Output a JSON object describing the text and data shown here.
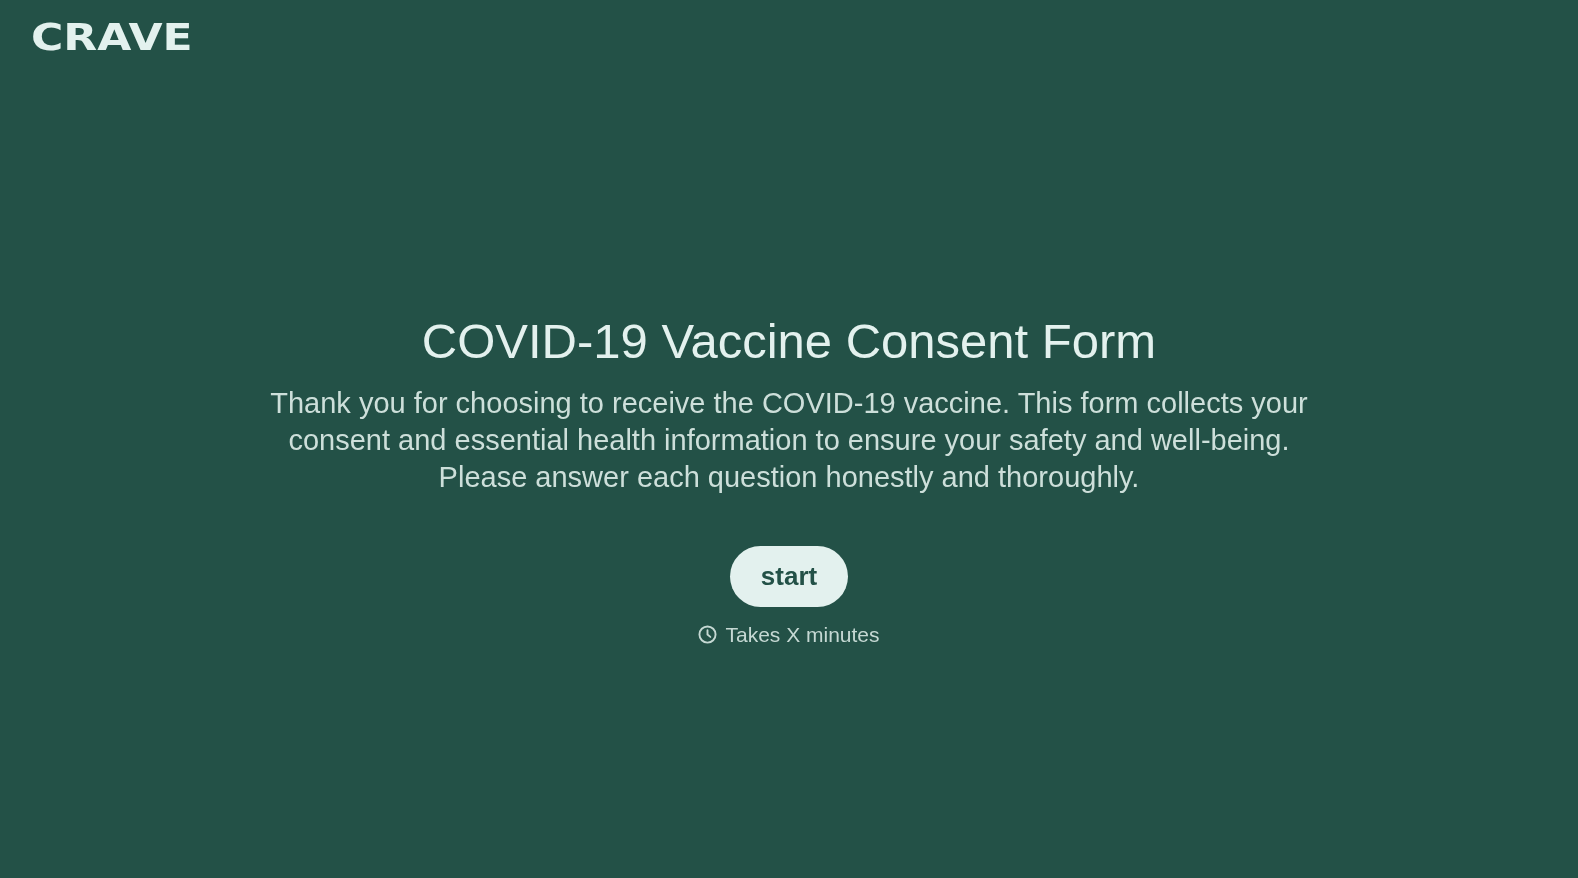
{
  "logo": {
    "text": "CRAVE"
  },
  "title": "COVID-19 Vaccine Consent Form",
  "description": "Thank you for choosing to receive the COVID-19 vaccine. This form collects your consent and essential health information to ensure your safety and well-being. Please answer each question honestly and thoroughly.",
  "start_button": {
    "label": "start"
  },
  "duration": {
    "text": "Takes X minutes"
  }
}
